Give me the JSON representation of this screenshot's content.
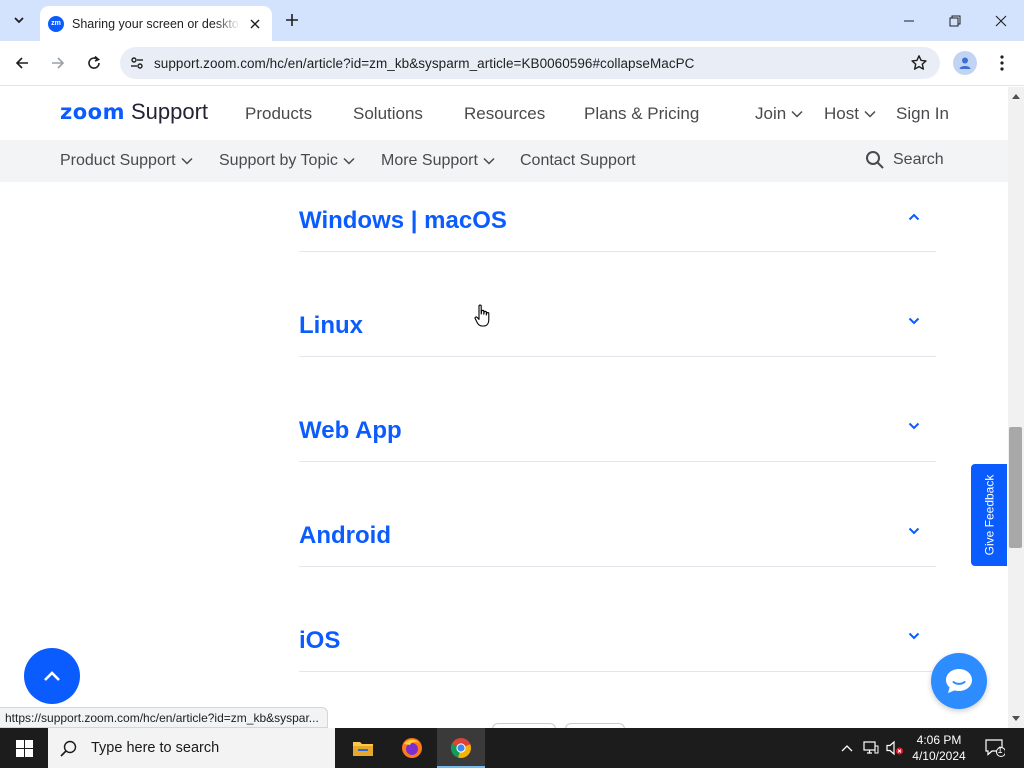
{
  "browser": {
    "tab_title": "Sharing your screen or desktop",
    "favicon_text": "zm",
    "url": "support.zoom.com/hc/en/article?id=zm_kb&sysparm_article=KB0060596#collapseMacPC",
    "status_url": "https://support.zoom.com/hc/en/article?id=zm_kb&syspar..."
  },
  "header": {
    "logo_word": "zoom",
    "logo_sub": "Support",
    "nav": [
      "Products",
      "Solutions",
      "Resources",
      "Plans & Pricing"
    ],
    "join": "Join",
    "host": "Host",
    "signin": "Sign In"
  },
  "subnav": {
    "product_support": "Product Support",
    "support_by_topic": "Support by Topic",
    "more_support": "More Support",
    "contact_support": "Contact Support",
    "search": "Search"
  },
  "accordion": [
    {
      "title": "Windows | macOS",
      "state": "expanded"
    },
    {
      "title": "Linux",
      "state": "collapsed"
    },
    {
      "title": "Web App",
      "state": "collapsed"
    },
    {
      "title": "Android",
      "state": "collapsed"
    },
    {
      "title": "iOS",
      "state": "collapsed"
    }
  ],
  "feedback": "Give Feedback",
  "taskbar": {
    "search_placeholder": "Type here to search",
    "time": "4:06 PM",
    "date": "4/10/2024",
    "notifications": "1"
  },
  "colors": {
    "brand": "#0b5cff",
    "tabbar": "#d3e3fd",
    "taskbar": "#1c1c1c"
  }
}
